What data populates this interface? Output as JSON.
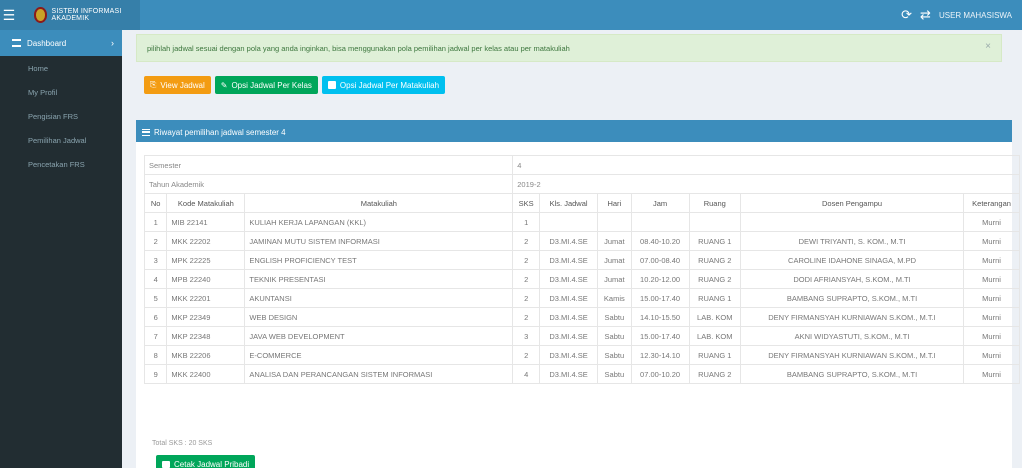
{
  "topbar": {
    "menu_icon": "hamburger-icon",
    "brand": "SISTEM INFORMASI AKADEMIK",
    "icons": [
      "refresh-icon",
      "share-icon"
    ],
    "user": "USER MAHASISWA"
  },
  "sidebar": {
    "active": "Dashboard",
    "items": [
      "Home",
      "My Profil",
      "Pengisian FRS",
      "Pemilihan Jadwal",
      "Pencetakan FRS"
    ]
  },
  "alert": {
    "text": "pilihlah jadwal sesuai dengan pola yang anda inginkan, bisa menggunakan pola pemilihan jadwal per kelas atau per matakuliah",
    "close": "×"
  },
  "buttons": {
    "view": "View Jadwal",
    "per_kelas": "Opsi Jadwal Per Kelas",
    "per_matakuliah": "Opsi Jadwal Per Matakuliah"
  },
  "box": {
    "title": "Riwayat pemilihan jadwal semester 4",
    "semester_label": "Semester",
    "semester_value": "4",
    "tahun_label": "Tahun Akademik",
    "tahun_value": "2019-2"
  },
  "table": {
    "headers": [
      "No",
      "Kode Matakuliah",
      "Matakuliah",
      "SKS",
      "Kls. Jadwal",
      "Hari",
      "Jam",
      "Ruang",
      "Dosen Pengampu",
      "Keterangan"
    ],
    "rows": [
      [
        "1",
        "MIB 22141",
        "KULIAH KERJA LAPANGAN (KKL)",
        "1",
        "",
        "",
        "",
        "",
        "",
        "Murni"
      ],
      [
        "2",
        "MKK 22202",
        "JAMINAN MUTU SISTEM INFORMASI",
        "2",
        "D3.MI.4.SE",
        "Jumat",
        "08.40-10.20",
        "RUANG 1",
        "DEWI TRIYANTI, S. KOM., M.TI",
        "Murni"
      ],
      [
        "3",
        "MPK 22225",
        "ENGLISH PROFICIENCY TEST",
        "2",
        "D3.MI.4.SE",
        "Jumat",
        "07.00-08.40",
        "RUANG 2",
        "CAROLINE IDAHONE SINAGA, M.PD",
        "Murni"
      ],
      [
        "4",
        "MPB 22240",
        "TEKNIK PRESENTASI",
        "2",
        "D3.MI.4.SE",
        "Jumat",
        "10.20-12.00",
        "RUANG 2",
        "DODI AFRIANSYAH, S.KOM., M.TI",
        "Murni"
      ],
      [
        "5",
        "MKK 22201",
        "AKUNTANSI",
        "2",
        "D3.MI.4.SE",
        "Kamis",
        "15.00-17.40",
        "RUANG 1",
        "BAMBANG SUPRAPTO, S.KOM., M.TI",
        "Murni"
      ],
      [
        "6",
        "MKP 22349",
        "WEB DESIGN",
        "2",
        "D3.MI.4.SE",
        "Sabtu",
        "14.10-15.50",
        "LAB. KOM",
        "DENY FIRMANSYAH KURNIAWAN S.KOM., M.T.I",
        "Murni"
      ],
      [
        "7",
        "MKP 22348",
        "JAVA WEB DEVELOPMENT",
        "3",
        "D3.MI.4.SE",
        "Sabtu",
        "15.00-17.40",
        "LAB. KOM",
        "AKNI WIDYASTUTI, S.KOM., M.TI",
        "Murni"
      ],
      [
        "8",
        "MKB 22206",
        "E-COMMERCE",
        "2",
        "D3.MI.4.SE",
        "Sabtu",
        "12.30-14.10",
        "RUANG 1",
        "DENY FIRMANSYAH KURNIAWAN S.KOM., M.T.I",
        "Murni"
      ],
      [
        "9",
        "MKK 22400",
        "ANALISA DAN PERANCANGAN SISTEM INFORMASI",
        "4",
        "D3.MI.4.SE",
        "Sabtu",
        "07.00-10.20",
        "RUANG 2",
        "BAMBANG SUPRAPTO, S.KOM., M.TI",
        "Murni"
      ]
    ]
  },
  "total": "Total SKS : 20 SKS",
  "print_button": "Cetak Jadwal Pribadi",
  "colors": {
    "topbar": "#3c8dbc",
    "sidebar": "#222d32",
    "orange": "#f39c12",
    "green": "#00a65a",
    "teal": "#00c0ef"
  }
}
